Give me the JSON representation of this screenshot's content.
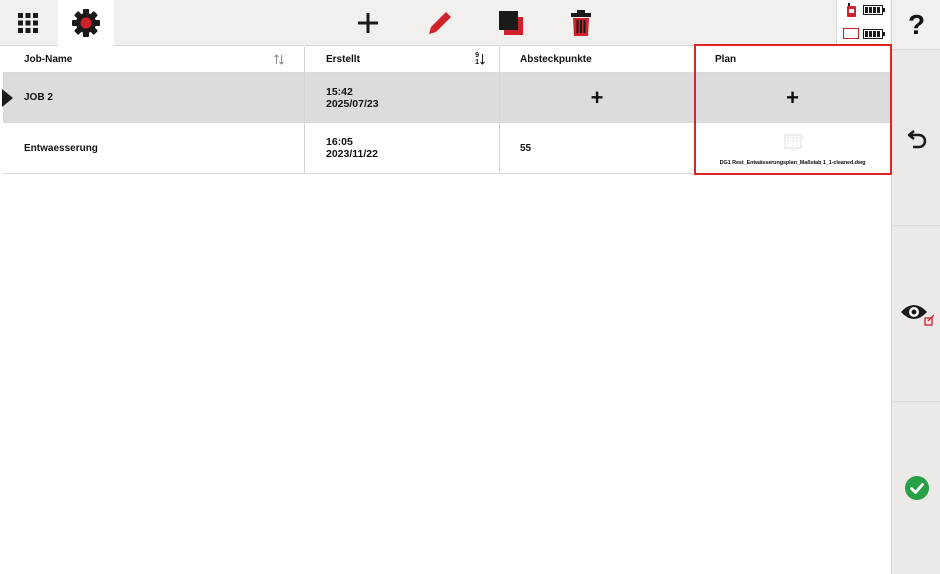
{
  "toolbar": {
    "icons": [
      "apps-grid-icon",
      "settings-gear-icon",
      "plus-icon",
      "pencil-icon",
      "copy-icon",
      "trash-icon"
    ],
    "accent_red": "#d0202a"
  },
  "status": {
    "icons": [
      "device-icon",
      "battery-icon",
      "controller-icon",
      "battery-icon"
    ]
  },
  "sidebar": {
    "help_label": "?",
    "icons": [
      "help-icon",
      "undo-icon",
      "eye-icon",
      "check-icon"
    ],
    "ok_color": "#27a046"
  },
  "table": {
    "headers": {
      "job_name": "Job-Name",
      "created": "Erstellt",
      "stakeout": "Absteckpunkte",
      "plan": "Plan"
    },
    "sort_digits": {
      "top": "9",
      "bottom": "1"
    },
    "rows": [
      {
        "name": "JOB 2",
        "time": "15:42",
        "date": "2025/07/23",
        "stakeout": "+",
        "plan": "+"
      },
      {
        "name": "Entwaesserung",
        "time": "16:05",
        "date": "2023/11/22",
        "stakeout": "55",
        "plan_file": "DG1 Rest_Entwässerungsplan_Maßstab 1_1-cleaned.dwg"
      }
    ]
  },
  "highlight_color": "#e02424"
}
